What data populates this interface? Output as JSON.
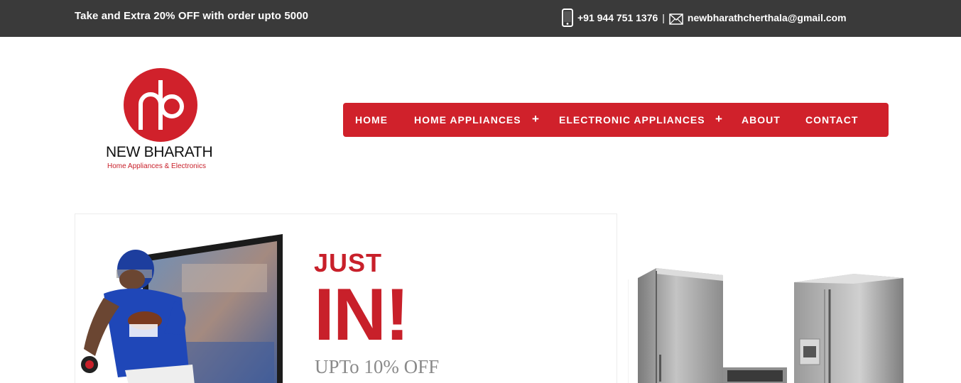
{
  "topbar": {
    "promo": "Take and Extra 20% OFF with order upto 5000",
    "phone_icon": "mobile-phone-icon",
    "phone": "+91 944 751 1376",
    "separator": "|",
    "mail_icon": "envelope-icon",
    "email": "newbharathcherthala@gmail.com"
  },
  "logo": {
    "monogram": "nb",
    "name": "NEW BHARATH",
    "tagline": "Home Appliances & Electronics"
  },
  "nav": {
    "items": [
      {
        "label": "HOME"
      },
      {
        "label": "HOME APPLIANCES",
        "expand": "+"
      },
      {
        "label": "ELECTRONIC APPLIANCES",
        "expand": "+"
      },
      {
        "label": "ABOUT"
      },
      {
        "label": "CONTACT"
      }
    ]
  },
  "banner": {
    "just": "JUST",
    "in": "IN!",
    "offer": "UPTo 10% OFF"
  },
  "colors": {
    "topbar": "#3a3a3a",
    "brand_red": "#d0212b",
    "offer_gray": "#8a8a8a"
  }
}
